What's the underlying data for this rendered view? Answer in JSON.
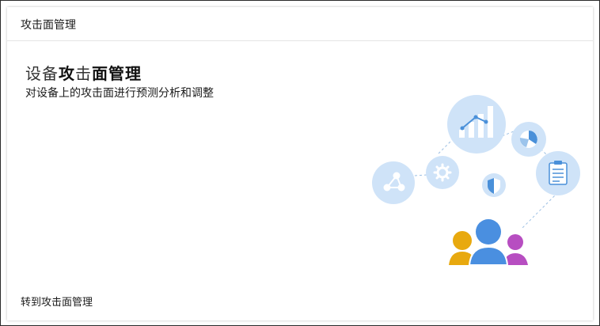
{
  "card": {
    "title": "攻击面管理"
  },
  "hero": {
    "title_light": "设备",
    "title_bold_1": "攻",
    "title_light_2": "击",
    "title_bold_2": "面管理",
    "subtitle": "对设备上的攻击面进行预测分析和调整"
  },
  "footer": {
    "link_label": "转到攻击面管理"
  },
  "colors": {
    "circle_fill": "#cfe3f8",
    "icon_blue": "#4a90d9",
    "person_yellow": "#e8a90f",
    "person_blue": "#4a8fe0",
    "person_purple": "#b74ec1"
  }
}
